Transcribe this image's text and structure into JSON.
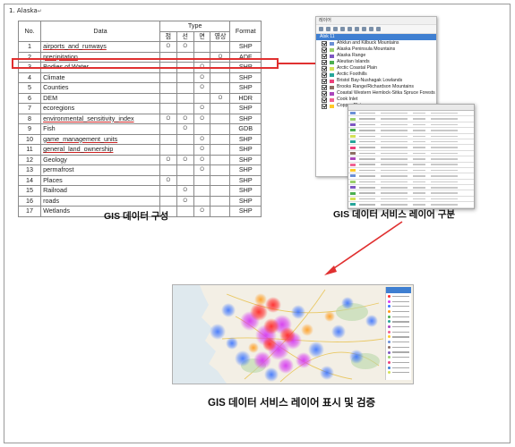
{
  "heading": {
    "num": "1.",
    "title": "Alaska",
    "mark": "↵"
  },
  "table": {
    "headers": {
      "no": "No.",
      "data": "Data",
      "type": "Type",
      "format": "Format"
    },
    "type_sub": [
      "점",
      "선",
      "면",
      "영상"
    ],
    "rows": [
      {
        "no": "1",
        "data": "airports_and_runways",
        "marks": [
          "O",
          "O",
          "",
          ""
        ],
        "format": "SHP",
        "underline": true
      },
      {
        "no": "2",
        "data": "precipitation",
        "marks": [
          "",
          "",
          "",
          "O"
        ],
        "format": "ADF",
        "underline": true
      },
      {
        "no": "3",
        "data": "Bodies of Water",
        "marks": [
          "",
          "",
          "O",
          ""
        ],
        "format": "SHP",
        "underline": false
      },
      {
        "no": "4",
        "data": "Climate",
        "marks": [
          "",
          "",
          "O",
          ""
        ],
        "format": "SHP",
        "underline": false
      },
      {
        "no": "5",
        "data": "Counties",
        "marks": [
          "",
          "",
          "O",
          ""
        ],
        "format": "SHP",
        "underline": false
      },
      {
        "no": "6",
        "data": "DEM",
        "marks": [
          "",
          "",
          "",
          "O"
        ],
        "format": "HDR",
        "underline": false
      },
      {
        "no": "7",
        "data": "ecoregions",
        "marks": [
          "",
          "",
          "O",
          ""
        ],
        "format": "SHP",
        "underline": false
      },
      {
        "no": "8",
        "data": "environmental_sensitivity_index",
        "marks": [
          "O",
          "O",
          "O",
          ""
        ],
        "format": "SHP",
        "underline": true
      },
      {
        "no": "9",
        "data": "Fish",
        "marks": [
          "",
          "O",
          "",
          ""
        ],
        "format": "GDB",
        "underline": false
      },
      {
        "no": "10",
        "data": "game_management_units",
        "marks": [
          "",
          "",
          "O",
          ""
        ],
        "format": "SHP",
        "underline": true
      },
      {
        "no": "11",
        "data": "general_land_ownership",
        "marks": [
          "",
          "",
          "O",
          ""
        ],
        "format": "SHP",
        "underline": true
      },
      {
        "no": "12",
        "data": "Geology",
        "marks": [
          "O",
          "O",
          "O",
          ""
        ],
        "format": "SHP",
        "underline": false
      },
      {
        "no": "13",
        "data": "permafrost",
        "marks": [
          "",
          "",
          "O",
          ""
        ],
        "format": "SHP",
        "underline": false
      },
      {
        "no": "14",
        "data": "Places",
        "marks": [
          "O",
          "",
          "",
          ""
        ],
        "format": "SHP",
        "underline": false
      },
      {
        "no": "15",
        "data": "Railroad",
        "marks": [
          "",
          "O",
          "",
          ""
        ],
        "format": "SHP",
        "underline": false
      },
      {
        "no": "16",
        "data": "roads",
        "marks": [
          "",
          "O",
          "",
          ""
        ],
        "format": "SHP",
        "underline": false
      },
      {
        "no": "17",
        "data": "Wetlands",
        "marks": [
          "",
          "",
          "O",
          ""
        ],
        "format": "SHP",
        "underline": false
      }
    ]
  },
  "captions": {
    "data_config": "GIS 데이터 구성",
    "layer_split": "GIS 데이터 서비스 레이어 구분",
    "layer_display": "GIS 데이터 서비스 레이어 표시 및 검증"
  },
  "layer_panel": {
    "title": "레이어",
    "root": "Alsk 11",
    "layers": [
      {
        "name": "Ahklun and Kilbuck Mountains",
        "color": "#6b8fd6"
      },
      {
        "name": "Alaska Peninsula Mountains",
        "color": "#9ad06a"
      },
      {
        "name": "Alaska Range",
        "color": "#7e57c2"
      },
      {
        "name": "Aleutian Islands",
        "color": "#4caf50"
      },
      {
        "name": "Arctic Coastal Plain",
        "color": "#d4e157"
      },
      {
        "name": "Arctic Foothills",
        "color": "#26a69a"
      },
      {
        "name": "Bristol Bay-Nushagak Lowlands",
        "color": "#ec407a"
      },
      {
        "name": "Brooks Range/Richardson Mountains",
        "color": "#8d6e63"
      },
      {
        "name": "Coastal Western Hemlock-Sitka Spruce Forests",
        "color": "#ab47bc"
      },
      {
        "name": "Cook Inlet",
        "color": "#f06292"
      },
      {
        "name": "Copper Plateau",
        "color": "#ffca28"
      }
    ]
  },
  "colors": {
    "highlight": "#e03030",
    "arrow": "#e03030",
    "accent": "#3f7fd1"
  }
}
